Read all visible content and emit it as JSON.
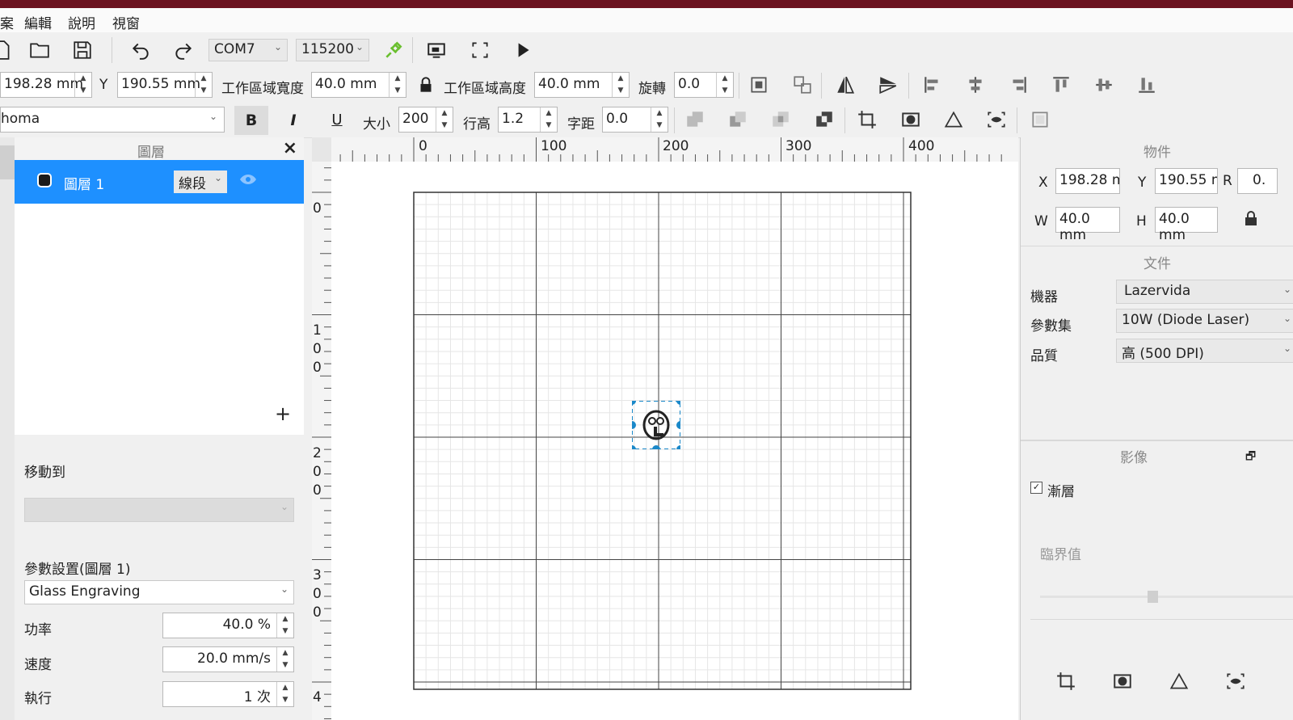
{
  "menu": [
    "案",
    "編輯",
    "說明",
    "視窗"
  ],
  "toolbar1": {
    "port": "COM7",
    "baud": "115200",
    "colors": {
      "connected": "#6abf2f"
    }
  },
  "toolbar2": {
    "x_value": "198.28 mm",
    "y_label": "Y",
    "y_value": "190.55 mm",
    "width_label": "工作區域寬度",
    "width_value": "40.0 mm",
    "height_label": "工作區域高度",
    "height_value": "40.0 mm",
    "rotate_label": "旋轉",
    "rotate_value": "0.0"
  },
  "toolbar3": {
    "font": "homa",
    "bold": "B",
    "italic": "I",
    "underline": "U",
    "size_label": "大小",
    "size_value": "200",
    "line_height_label": "行高",
    "line_height_value": "1.2",
    "spacing_label": "字距",
    "spacing_value": "0.0"
  },
  "layers": {
    "title": "圖層",
    "close": "×",
    "items": [
      {
        "name": "圖層 1",
        "mode": "線段"
      }
    ],
    "add": "+",
    "colors": {
      "selected": "#1e90ff"
    }
  },
  "layer_settings": {
    "move_to_label": "移動到",
    "params_label": "參數設置(圖層 1)",
    "preset": "Glass Engraving",
    "power_label": "功率",
    "power_value": "40.0 %",
    "speed_label": "速度",
    "speed_value": "20.0 mm/s",
    "passes_label": "執行",
    "passes_value": "1 次"
  },
  "ruler": {
    "h_labels": [
      "0",
      "100",
      "200",
      "300",
      "400"
    ],
    "v_labels": [
      [
        "0"
      ],
      [
        "1",
        "0",
        "0"
      ],
      [
        "2",
        "0",
        "0"
      ],
      [
        "3",
        "0",
        "0"
      ],
      [
        "4"
      ]
    ]
  },
  "object_panel": {
    "title": "物件",
    "x_label": "X",
    "x_value": "198.28 m",
    "y_label": "Y",
    "y_value": "190.55 m",
    "r_label": "R",
    "r_value": "0.",
    "w_label": "W",
    "w_value": "40.0 mm",
    "h_label": "H",
    "h_value": "40.0 mm"
  },
  "document_panel": {
    "title": "文件",
    "machine_label": "機器",
    "machine_value": "Lazervida",
    "preset_label": "參數集",
    "preset_value": "10W (Diode Laser)",
    "quality_label": "品質",
    "quality_value": "高 (500 DPI)"
  },
  "image_panel": {
    "title": "影像",
    "gradient_label": "漸層",
    "threshold_label": "臨界值"
  }
}
